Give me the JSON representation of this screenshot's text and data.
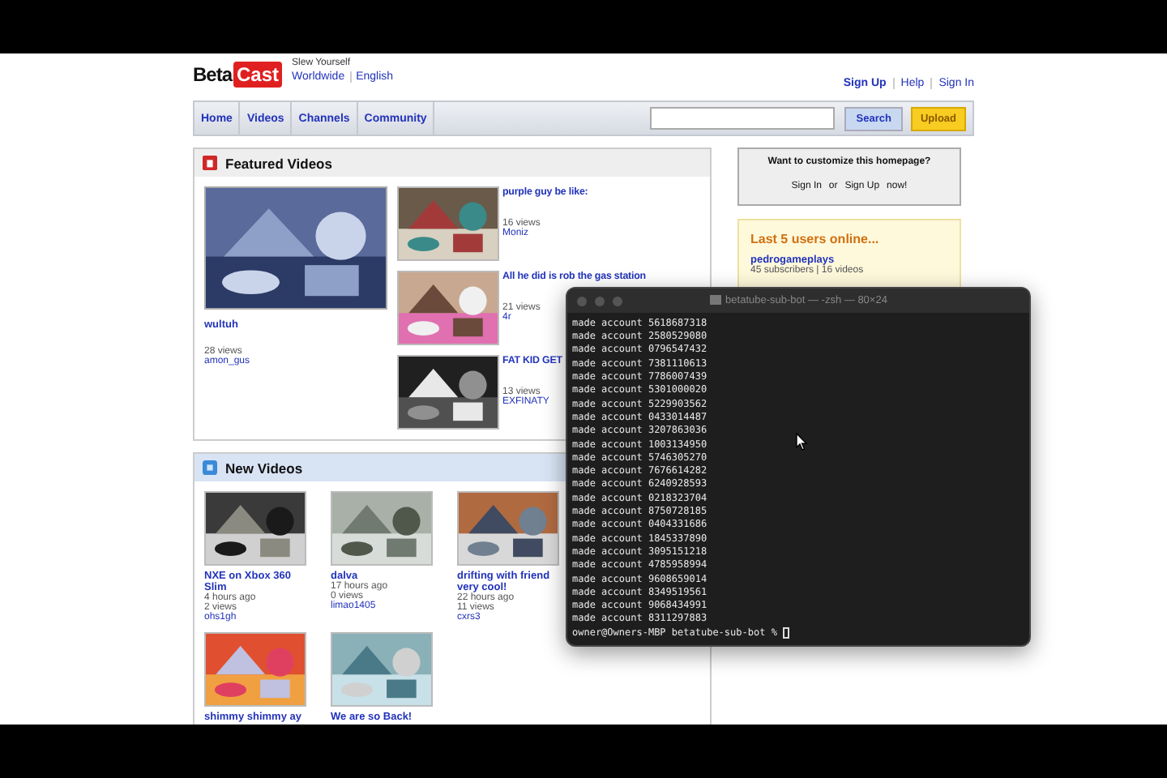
{
  "header": {
    "logo_left": "Beta",
    "logo_right": "Cast",
    "tagline": "Slew Yourself",
    "locale_links": [
      "Worldwide",
      "English"
    ],
    "account_links": [
      "Sign Up",
      "Help",
      "Sign In"
    ]
  },
  "nav": {
    "items": [
      "Home",
      "Videos",
      "Channels",
      "Community"
    ],
    "search_button": "Search",
    "upload_button": "Upload"
  },
  "featured": {
    "title": "Featured Videos",
    "main": {
      "title": "wultuh",
      "views": "28 views",
      "user": "amon_gus"
    },
    "list": [
      {
        "title": "purple guy be like:",
        "views": "16 views",
        "user": "Moniz"
      },
      {
        "title": "All he did is rob the gas station",
        "views": "21 views",
        "user": "4r"
      },
      {
        "title": "FAT KID GET",
        "views": "13 views",
        "user": "EXFINATY"
      }
    ]
  },
  "customize": {
    "question": "Want to customize this homepage?",
    "sign_in": "Sign In",
    "middle": "or",
    "sign_up": "Sign Up",
    "end": "now!"
  },
  "users_online": {
    "title": "Last 5 users online...",
    "users": [
      {
        "name": "pedrogameplays",
        "stats": "45 subscribers | 16 videos"
      }
    ]
  },
  "new_videos": {
    "title": "New Videos",
    "videos": [
      {
        "title": "NXE on Xbox 360 Slim",
        "age": "4 hours ago",
        "views": "2 views",
        "user": "ohs1gh"
      },
      {
        "title": "dalva",
        "age": "17 hours ago",
        "views": "0 views",
        "user": "limao1405"
      },
      {
        "title": "drifting with friend very cool!",
        "age": "22 hours ago",
        "views": "11 views",
        "user": "cxrs3"
      },
      {
        "title": "shimmy shimmy ay"
      },
      {
        "title": "We are so Back!"
      }
    ]
  },
  "terminal": {
    "title": "betatube-sub-bot — -zsh — 80×24",
    "lines": [
      "made account 5618687318",
      "made account 2580529080",
      "made account 0796547432",
      "made account 7381110613",
      "made account 7786007439",
      "made account 5301000020",
      "made account 5229903562",
      "made account 0433014487",
      "made account 3207863036",
      "made account 1003134950",
      "made account 5746305270",
      "made account 7676614282",
      "made account 6240928593",
      "made account 0218323704",
      "made account 8750728185",
      "made account 0404331686",
      "made account 1845337890",
      "made account 3095151218",
      "made account 4785958994",
      "made account 9608659014",
      "made account 8349519561",
      "made account 9068434991",
      "made account 8311297883"
    ],
    "prompt": "owner@Owners-MBP betatube-sub-bot % "
  }
}
